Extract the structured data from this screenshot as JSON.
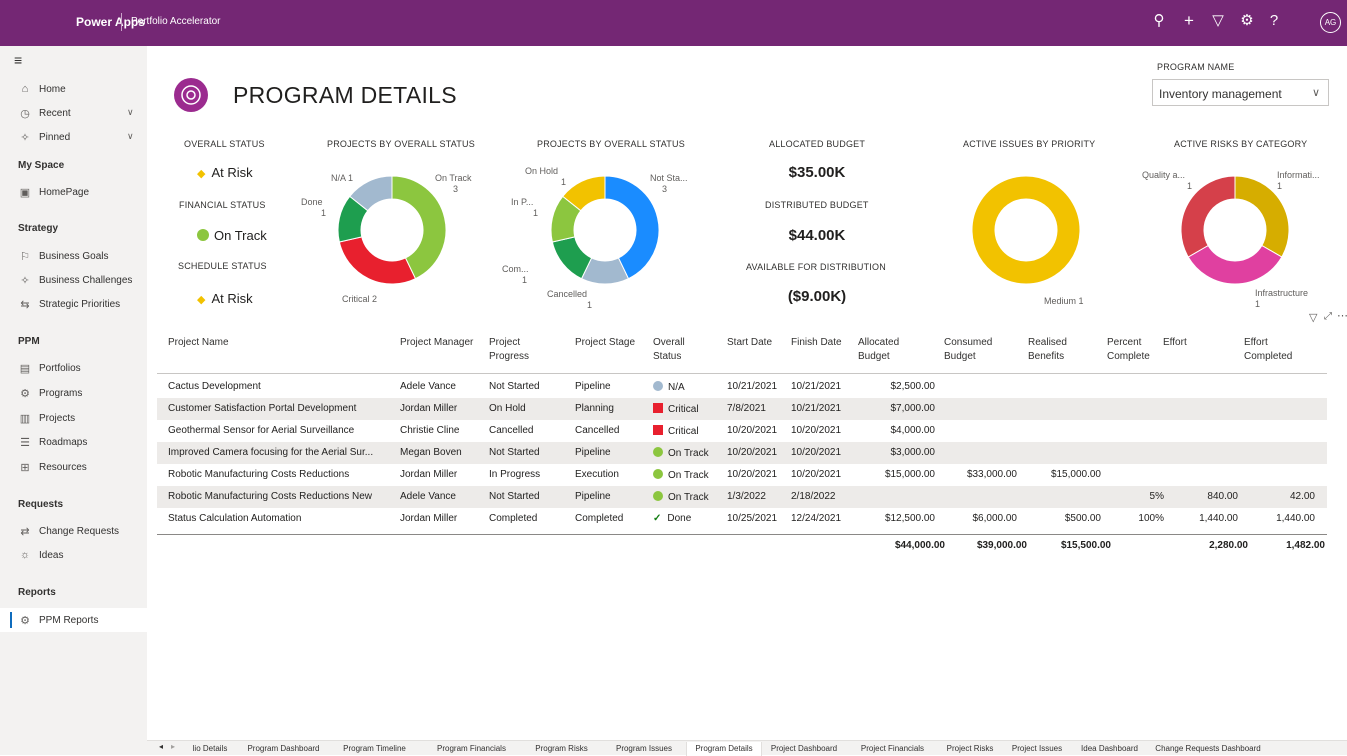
{
  "topbar": {
    "brand": "Power Apps",
    "app_name": "Portfolio Accelerator",
    "avatar": "AG",
    "icons": [
      "search-icon",
      "plus-icon",
      "filter-icon",
      "gear-icon",
      "help-icon"
    ]
  },
  "nav": {
    "items": [
      {
        "label": "Home",
        "icon": "⌂"
      },
      {
        "label": "Recent",
        "icon": "◷"
      },
      {
        "label": "Pinned",
        "icon": "✧"
      }
    ],
    "sections": {
      "my_space": "My Space",
      "strategy": "Strategy",
      "ppm": "PPM",
      "requests": "Requests",
      "reports": "Reports"
    },
    "my_space": [
      {
        "label": "HomePage",
        "icon": "▣"
      }
    ],
    "strategy": [
      {
        "label": "Business Goals",
        "icon": "⚐"
      },
      {
        "label": "Business Challenges",
        "icon": "✧"
      },
      {
        "label": "Strategic Priorities",
        "icon": "⇆"
      }
    ],
    "ppm": [
      {
        "label": "Portfolios",
        "icon": "▤"
      },
      {
        "label": "Programs",
        "icon": "⚙"
      },
      {
        "label": "Projects",
        "icon": "▥"
      },
      {
        "label": "Roadmaps",
        "icon": "☰"
      },
      {
        "label": "Resources",
        "icon": "⊞"
      }
    ],
    "requests": [
      {
        "label": "Change Requests",
        "icon": "⇄"
      },
      {
        "label": "Ideas",
        "icon": "☼"
      }
    ],
    "reports": [
      {
        "label": "PPM Reports",
        "icon": "⚙"
      }
    ]
  },
  "header": {
    "title": "PROGRAM DETAILS",
    "program_name_label": "PROGRAM NAME",
    "program_name_value": "Inventory management"
  },
  "statuses": {
    "overall_label": "OVERALL STATUS",
    "overall_value": "At Risk",
    "financial_label": "FINANCIAL STATUS",
    "financial_value": "On Track",
    "schedule_label": "SCHEDULE STATUS",
    "schedule_value": "At Risk"
  },
  "budget": {
    "allocated_label": "ALLOCATED BUDGET",
    "allocated_value": "$35.00K",
    "distributed_label": "DISTRIBUTED BUDGET",
    "distributed_value": "$44.00K",
    "available_label": "AVAILABLE FOR DISTRIBUTION",
    "available_value": "($9.00K)"
  },
  "colors": {
    "brand": "#742774",
    "on_track": "#8cc63f",
    "critical": "#e8202e",
    "done": "#1e9e4f",
    "na": "#a2b9cf",
    "at_risk": "#f2c200",
    "not_started": "#1a8cff"
  },
  "chart_data": [
    {
      "type": "pie",
      "title": "PROJECTS BY OVERALL STATUS",
      "labels": [
        "On Track",
        "Critical",
        "Done",
        "N/A"
      ],
      "values": [
        3,
        2,
        1,
        1
      ],
      "colors": [
        "#8cc63f",
        "#e8202e",
        "#1e9e4f",
        "#a2b9cf"
      ],
      "data_labels": [
        "On Track",
        "Critical 2",
        "Done",
        "N/A 1"
      ],
      "value_labels": [
        "3",
        "",
        "1",
        ""
      ]
    },
    {
      "type": "pie",
      "title": "PROJECTS BY OVERALL STATUS",
      "labels": [
        "Not Sta...",
        "Cancelled",
        "Com...",
        "In P...",
        "On Hold"
      ],
      "values": [
        3,
        1,
        1,
        1,
        1
      ],
      "colors": [
        "#1a8cff",
        "#a2b9cf",
        "#1e9e4f",
        "#8cc63f",
        "#f2c200"
      ],
      "data_labels": [
        "Not Sta...",
        "Cancelled",
        "Com...",
        "In P...",
        "On Hold"
      ],
      "value_labels": [
        "3",
        "1",
        "1",
        "1",
        "1"
      ]
    },
    {
      "type": "pie",
      "title": "ACTIVE ISSUES BY PRIORITY",
      "labels": [
        "Medium"
      ],
      "values": [
        1
      ],
      "colors": [
        "#f2c200"
      ],
      "data_labels": [
        "Medium 1"
      ]
    },
    {
      "type": "pie",
      "title": "ACTIVE RISKS BY CATEGORY",
      "labels": [
        "Informati...",
        "Infrastructure",
        "Quality a..."
      ],
      "values": [
        1,
        1,
        1
      ],
      "colors": [
        "#d6ad00",
        "#e040a0",
        "#d5404a"
      ],
      "data_labels": [
        "Informati...",
        "Infrastructure",
        "Quality a..."
      ],
      "value_labels": [
        "1",
        "1",
        "1"
      ]
    }
  ],
  "table": {
    "headers": [
      "Project Name",
      "Project Manager",
      "Project Progress",
      "Project Stage",
      "Overall Status",
      "Start Date",
      "Finish Date",
      "Allocated Budget",
      "Consumed Budget",
      "Realised Benefits",
      "Percent Complete",
      "Effort",
      "Effort Completed"
    ],
    "rows": [
      {
        "name": "Cactus Development",
        "manager": "Adele Vance",
        "progress": "Not Started",
        "stage": "Pipeline",
        "status": "N/A",
        "status_kind": "na",
        "start": "10/21/2021",
        "finish": "10/21/2021",
        "allocated": "$2,500.00",
        "consumed": "",
        "realised": "",
        "percent": "",
        "effort": "",
        "effort_done": ""
      },
      {
        "name": "Customer Satisfaction Portal Development",
        "manager": "Jordan Miller",
        "progress": "On Hold",
        "stage": "Planning",
        "status": "Critical",
        "status_kind": "critical",
        "start": "7/8/2021",
        "finish": "10/21/2021",
        "allocated": "$7,000.00",
        "consumed": "",
        "realised": "",
        "percent": "",
        "effort": "",
        "effort_done": ""
      },
      {
        "name": "Geothermal Sensor for Aerial Surveillance",
        "manager": "Christie Cline",
        "progress": "Cancelled",
        "stage": "Cancelled",
        "status": "Critical",
        "status_kind": "critical",
        "start": "10/20/2021",
        "finish": "10/20/2021",
        "allocated": "$4,000.00",
        "consumed": "",
        "realised": "",
        "percent": "",
        "effort": "",
        "effort_done": ""
      },
      {
        "name": "Improved Camera focusing for the Aerial Sur...",
        "manager": "Megan Boven",
        "progress": "Not Started",
        "stage": "Pipeline",
        "status": "On Track",
        "status_kind": "ontrack",
        "start": "10/20/2021",
        "finish": "10/20/2021",
        "allocated": "$3,000.00",
        "consumed": "",
        "realised": "",
        "percent": "",
        "effort": "",
        "effort_done": ""
      },
      {
        "name": "Robotic Manufacturing Costs Reductions",
        "manager": "Jordan Miller",
        "progress": "In Progress",
        "stage": "Execution",
        "status": "On Track",
        "status_kind": "ontrack",
        "start": "10/20/2021",
        "finish": "10/20/2021",
        "allocated": "$15,000.00",
        "consumed": "$33,000.00",
        "realised": "$15,000.00",
        "percent": "",
        "effort": "",
        "effort_done": ""
      },
      {
        "name": "Robotic Manufacturing Costs Reductions New",
        "manager": "Adele Vance",
        "progress": "Not Started",
        "stage": "Pipeline",
        "status": "On Track",
        "status_kind": "ontrack",
        "start": "1/3/2022",
        "finish": "2/18/2022",
        "allocated": "",
        "consumed": "",
        "realised": "",
        "percent": "5%",
        "effort": "840.00",
        "effort_done": "42.00"
      },
      {
        "name": "Status Calculation Automation",
        "manager": "Jordan Miller",
        "progress": "Completed",
        "stage": "Completed",
        "status": "Done",
        "status_kind": "done",
        "start": "10/25/2021",
        "finish": "12/24/2021",
        "allocated": "$12,500.00",
        "consumed": "$6,000.00",
        "realised": "$500.00",
        "percent": "100%",
        "effort": "1,440.00",
        "effort_done": "1,440.00"
      }
    ],
    "totals": {
      "allocated": "$44,000.00",
      "consumed": "$39,000.00",
      "realised": "$15,500.00",
      "effort": "2,280.00",
      "effort_done": "1,482.00"
    }
  },
  "tabs": [
    "lio Details",
    "Program Dashboard",
    "Program Timeline",
    "Program Financials",
    "Program Risks",
    "Program Issues",
    "Program Details",
    "Project Dashboard",
    "Project Financials",
    "Project Risks",
    "Project Issues",
    "Idea Dashboard",
    "Change Requests Dashboard"
  ],
  "active_tab": "Program Details"
}
